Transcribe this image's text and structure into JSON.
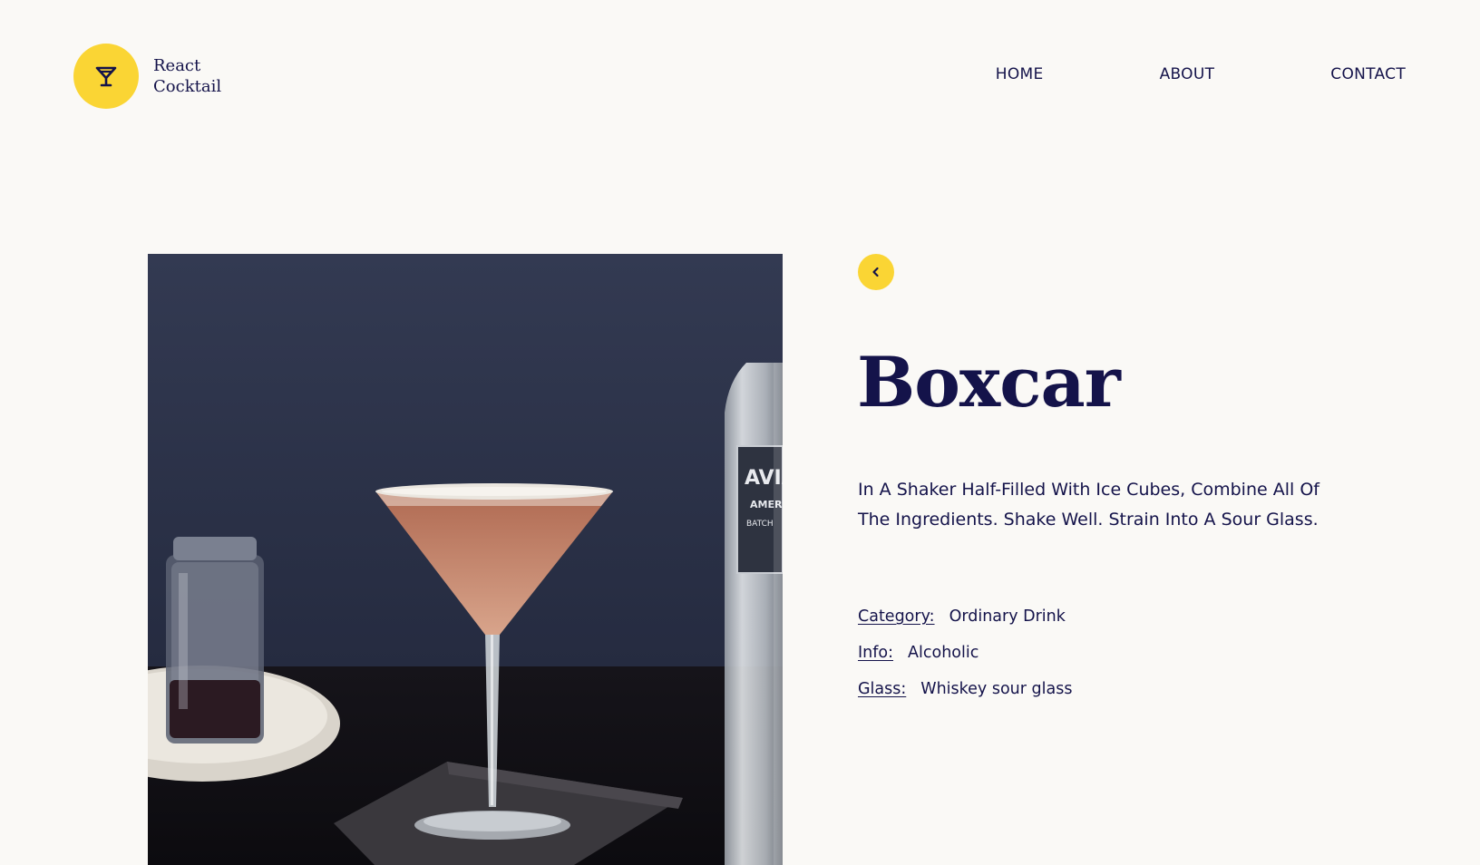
{
  "header": {
    "logo": {
      "line1": "React",
      "line2": "Cocktail",
      "icon": "cocktail-glass-icon",
      "color": "#fad534"
    },
    "nav": {
      "home": "HOME",
      "about": "ABOUT",
      "contact": "CONTACT"
    }
  },
  "drink": {
    "name": "Boxcar",
    "instructions": "In A Shaker Half-Filled With Ice Cubes, Combine All Of The Ingredients. Shake Well. Strain Into A Sour Glass.",
    "details": [
      {
        "label": "Category:",
        "value": "Ordinary Drink"
      },
      {
        "label": "Info:",
        "value": "Alcoholic"
      },
      {
        "label": "Glass:",
        "value": "Whiskey sour glass"
      }
    ]
  },
  "back_button": {
    "icon": "chevron-left-icon"
  },
  "colors": {
    "accent": "#fad534",
    "text": "#14134a",
    "background": "#faf9f6"
  }
}
